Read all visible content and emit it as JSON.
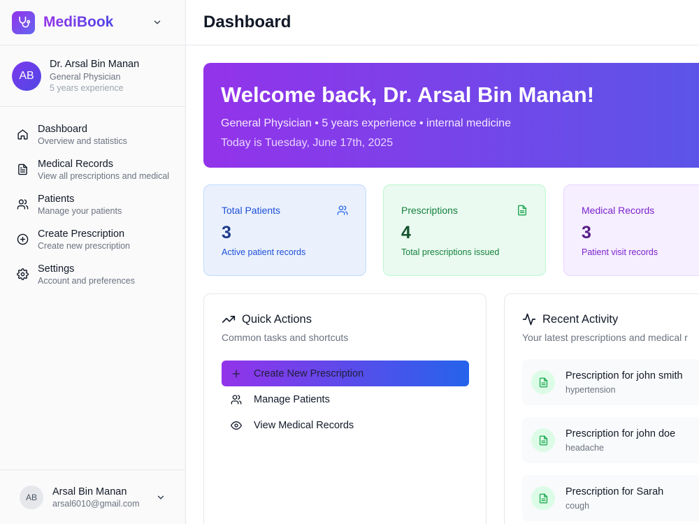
{
  "brand": {
    "name": "MediBook",
    "logo_icon": "stethoscope-icon",
    "accent": "#9333ea"
  },
  "doctor": {
    "initials": "AB",
    "name": "Dr. Arsal Bin Manan",
    "specialty": "General Physician",
    "experience": "5 years experience"
  },
  "nav": [
    {
      "label": "Dashboard",
      "desc": "Overview and statistics",
      "icon": "home-icon"
    },
    {
      "label": "Medical Records",
      "desc": "View all prescriptions and medical",
      "icon": "file-text-icon"
    },
    {
      "label": "Patients",
      "desc": "Manage your patients",
      "icon": "users-icon"
    },
    {
      "label": "Create Prescription",
      "desc": "Create new prescription",
      "icon": "plus-circle-icon"
    },
    {
      "label": "Settings",
      "desc": "Account and preferences",
      "icon": "gear-icon"
    }
  ],
  "user": {
    "initials": "AB",
    "name": "Arsal Bin Manan",
    "email": "arsal6010@gmail.com"
  },
  "header": {
    "title": "Dashboard"
  },
  "hero": {
    "title": "Welcome back, Dr. Arsal Bin Manan!",
    "subtitle": "General Physician • 5 years experience • internal medicine",
    "date": "Today is Tuesday, June 17th, 2025"
  },
  "stats": [
    {
      "title": "Total Patients",
      "value": "3",
      "desc": "Active patient records",
      "color": "#1d4ed8"
    },
    {
      "title": "Prescriptions",
      "value": "4",
      "desc": "Total prescriptions issued",
      "color": "#15803d"
    },
    {
      "title": "Medical Records",
      "value": "3",
      "desc": "Patient visit records",
      "color": "#7e22ce"
    }
  ],
  "quick_actions": {
    "title": "Quick Actions",
    "subtitle": "Common tasks and shortcuts",
    "items": [
      {
        "label": "Create New Prescription",
        "icon": "plus-icon"
      },
      {
        "label": "Manage Patients",
        "icon": "users-icon"
      },
      {
        "label": "View Medical Records",
        "icon": "eye-icon"
      }
    ]
  },
  "recent_activity": {
    "title": "Recent Activity",
    "subtitle": "Your latest prescriptions and medical r",
    "items": [
      {
        "title": "Prescription for john smith",
        "desc": "hypertension"
      },
      {
        "title": "Prescription for john doe",
        "desc": "headache"
      },
      {
        "title": "Prescription for Sarah",
        "desc": "cough"
      }
    ]
  }
}
